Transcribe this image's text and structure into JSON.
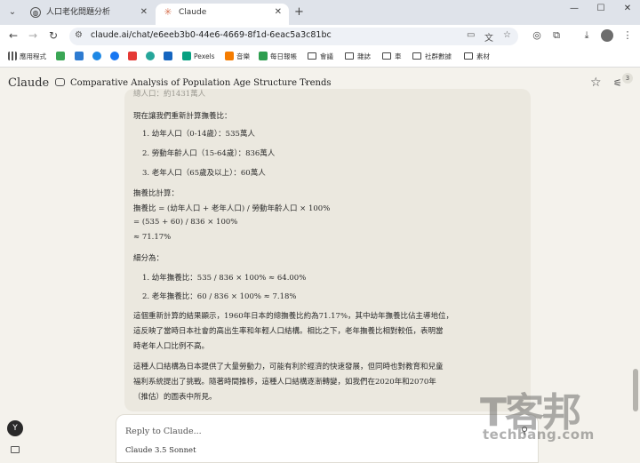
{
  "browser": {
    "tabs": [
      {
        "title": "人口老化問題分析",
        "icon": "globe-icon"
      },
      {
        "title": "Claude",
        "icon": "claude-sparkle-icon"
      }
    ],
    "url": "claude.ai/chat/e6eeb3b0-44e6-4669-8f1d-6eac5a3c81bc"
  },
  "bookmarks": [
    {
      "label": "應用程式",
      "icon": "apps-grid-icon"
    },
    {
      "label": "",
      "icon": "green-bookmark-icon"
    },
    {
      "label": "",
      "icon": "blue-bookmark-icon"
    },
    {
      "label": "",
      "icon": "circle-bookmark-icon"
    },
    {
      "label": "",
      "icon": "meta-icon"
    },
    {
      "label": "",
      "icon": "trend-icon"
    },
    {
      "label": "",
      "icon": "teal-bookmark-icon"
    },
    {
      "label": "",
      "icon": "b-icon"
    },
    {
      "label": "Pexels",
      "icon": "pexels-icon"
    },
    {
      "label": "音樂",
      "icon": "music-icon"
    },
    {
      "label": "每日報帳",
      "icon": "plus-icon"
    },
    {
      "label": "會議",
      "icon": "folder-icon"
    },
    {
      "label": "雜誌",
      "icon": "folder-icon"
    },
    {
      "label": "車",
      "icon": "folder-icon"
    },
    {
      "label": "社群數據",
      "icon": "folder-icon"
    },
    {
      "label": "素材",
      "icon": "folder-icon"
    }
  ],
  "app": {
    "brand": "Claude",
    "chat_title": "Comparative Analysis of Population Age Structure Trends",
    "badge_count": "3"
  },
  "message": {
    "cutoff_line": "總人口：約1431萬人",
    "lines": [
      "現在讓我們重新計算撫養比：",
      "1. 幼年人口（0-14歲）：535萬人",
      "2. 勞動年齡人口（15-64歲）：836萬人",
      "3. 老年人口（65歲及以上）：60萬人",
      "撫養比計算：",
      "撫養比 = (幼年人口 + 老年人口) / 勞動年齡人口 × 100%",
      "= (535 + 60) / 836 × 100%",
      "≈ 71.17%",
      "細分為：",
      "1. 幼年撫養比：535 / 836 × 100% ≈ 64.00%",
      "2. 老年撫養比：60 / 836 × 100% ≈ 7.18%",
      "這個重新計算的結果顯示，1960年日本的總撫養比約為71.17%，其中幼年撫養比佔主導地位，",
      "這反映了當時日本社會的高出生率和年輕人口結構。相比之下，老年撫養比相對較低，表明當",
      "時老年人口比例不高。",
      "這種人口結構為日本提供了大量勞動力，可能有利於經濟的快速發展，但同時也對教育和兒童",
      "福利系統提出了挑戰。隨著時間推移，這種人口結構逐漸轉變，如我們在2020年和2070年",
      "（推估）的圖表中所見。"
    ]
  },
  "composer": {
    "placeholder": "Reply to Claude...",
    "model": "Claude 3.5 Sonnet"
  },
  "user": {
    "initial": "Y"
  },
  "watermark": {
    "logo": "T客邦",
    "site": "techbang.com"
  }
}
